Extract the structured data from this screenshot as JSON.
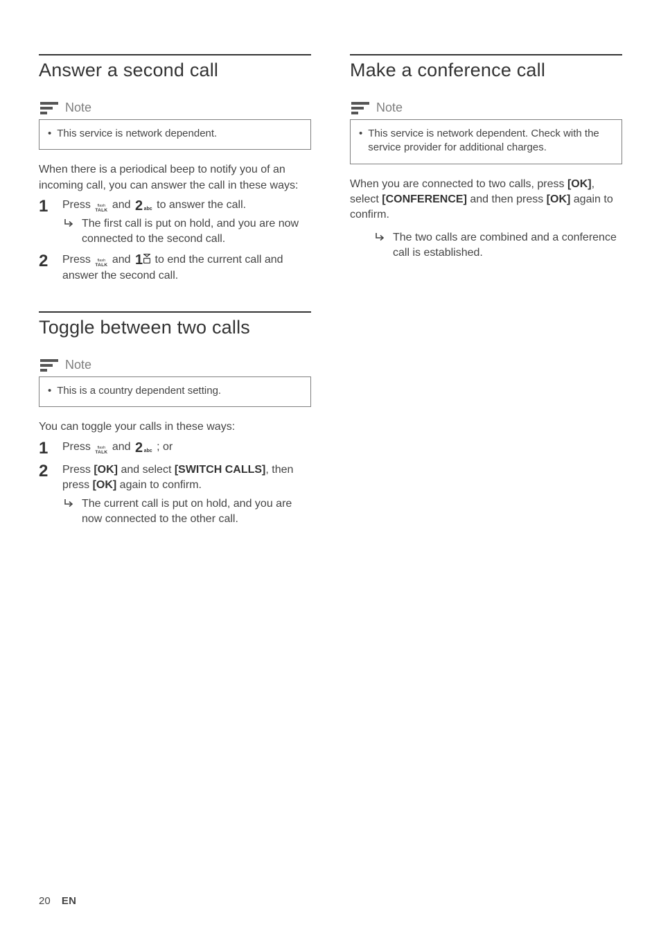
{
  "left": {
    "section1": {
      "heading": "Answer a second call",
      "note_label": "Note",
      "note_text": "This service is network dependent.",
      "intro": "When there is a periodical beep to notify you of an incoming call, you can answer the call in these ways:",
      "step1_a": "Press ",
      "step1_b": " and ",
      "step1_c": " to answer the call.",
      "step1_result": "The first call is put on hold, and you are now connected to the second call.",
      "step2_a": "Press ",
      "step2_b": " and ",
      "step2_c": " to end the current call and answer the second call."
    },
    "section2": {
      "heading": "Toggle between two calls",
      "note_label": "Note",
      "note_text": "This is a country dependent setting.",
      "intro": "You can toggle your calls in these ways:",
      "step1_a": "Press ",
      "step1_b": " and ",
      "step1_c": " ; or",
      "step2_a": "Press ",
      "step2_ok1": "[OK]",
      "step2_b": " and select ",
      "step2_switch": "[SWITCH CALLS]",
      "step2_c": ", then press ",
      "step2_ok2": "[OK]",
      "step2_d": " again to confirm.",
      "step2_result": "The current call is put on hold, and you are now connected to the other call."
    }
  },
  "right": {
    "section1": {
      "heading": "Make a conference call",
      "note_label": "Note",
      "note_text": "This service is network dependent. Check with the service provider for additional charges.",
      "para_a": "When you are connected to two calls, press ",
      "para_ok1": "[OK]",
      "para_b": ", select ",
      "para_conf": "[CONFERENCE]",
      "para_c": " and then press ",
      "para_ok2": "[OK]",
      "para_d": " again to confirm.",
      "result": "The two calls are combined and a conference call is established."
    }
  },
  "footer": {
    "page_number": "20",
    "lang": "EN"
  },
  "icons": {
    "talk_flash": "flash",
    "talk_talk": "TALK",
    "two": "2",
    "abc": "abc",
    "one": "1"
  }
}
